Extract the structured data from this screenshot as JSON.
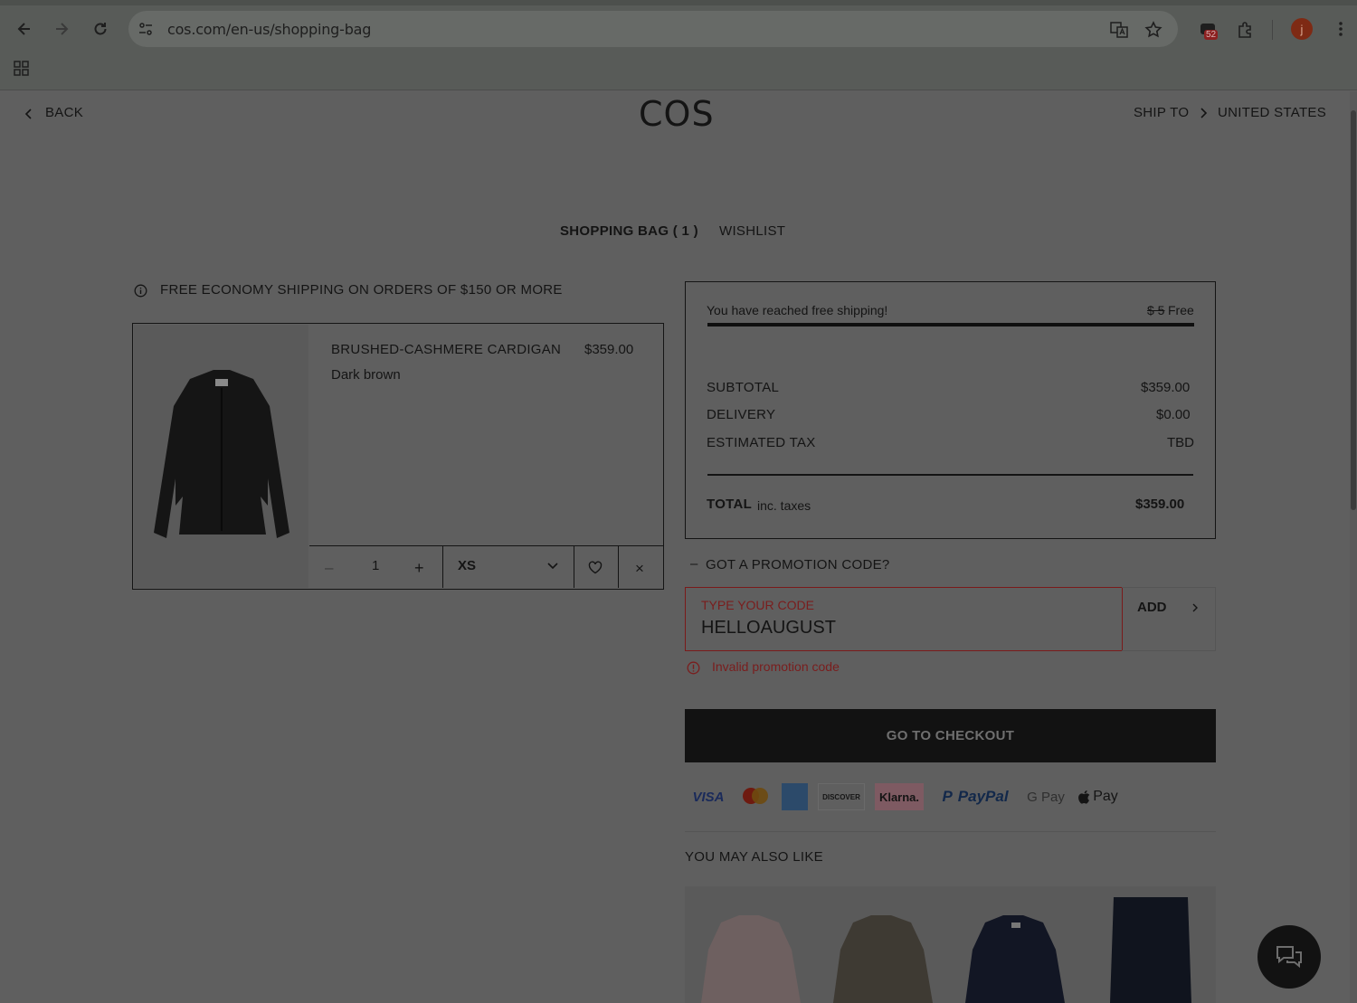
{
  "browser": {
    "url": "cos.com/en-us/shopping-bag",
    "extensions_badge": "52",
    "profile_initial": "j"
  },
  "header": {
    "back": "BACK",
    "logo": "COS",
    "ship_to": "SHIP TO",
    "country": "UNITED STATES"
  },
  "tabs": {
    "bag": "SHOPPING BAG ( 1 )",
    "wishlist": "WISHLIST"
  },
  "banner": "FREE ECONOMY SHIPPING ON ORDERS OF $150 OR MORE",
  "item": {
    "name": "BRUSHED-CASHMERE CARDIGAN",
    "price": "$359.00",
    "color": "Dark brown",
    "quantity": "1",
    "size": "XS",
    "minus": "–",
    "plus": "+",
    "remove": "×"
  },
  "summary": {
    "free_shipping_msg": "You have reached free shipping!",
    "shipping_old": "$ 5",
    "shipping_new": "Free",
    "shipping_progress": 1.0,
    "subtotal_label": "SUBTOTAL",
    "subtotal": "$359.00",
    "delivery_label": "DELIVERY",
    "delivery": "$0.00",
    "tax_label": "ESTIMATED TAX",
    "tax": "TBD",
    "total_label": "TOTAL",
    "total_note": "inc. taxes",
    "total": "$359.00"
  },
  "promo": {
    "toggle": "–",
    "title": "GOT A PROMOTION CODE?",
    "label": "TYPE YOUR CODE",
    "value": "HELLOAUGUST",
    "add": "ADD",
    "error": "Invalid promotion code"
  },
  "checkout": "GO TO CHECKOUT",
  "payments": {
    "visa": "VISA",
    "discover": "DISCOVER",
    "klarna": "Klarna.",
    "paypal": "PayPal",
    "gpay": "G Pay",
    "applepay": "Pay"
  },
  "recommend_title": "YOU MAY ALSO LIKE",
  "colors": {
    "overlay_bg": "#5f5f5f",
    "error_red": "#8a1a1a",
    "checkout_bg": "#121212"
  }
}
